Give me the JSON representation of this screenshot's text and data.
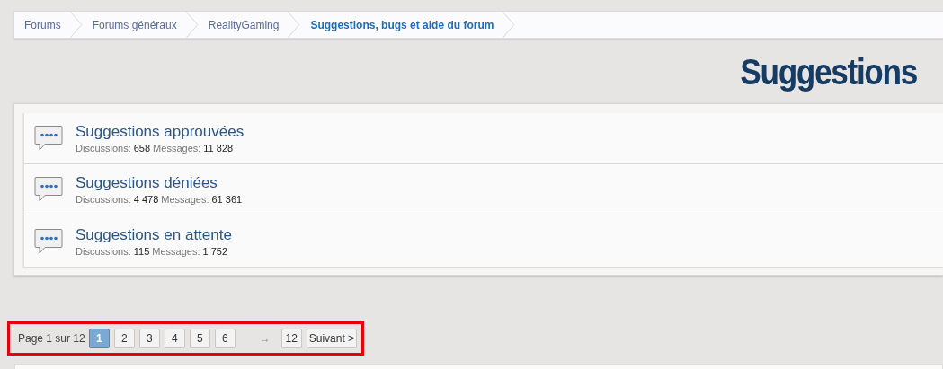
{
  "breadcrumb": [
    {
      "label": "Forums",
      "current": false
    },
    {
      "label": "Forums généraux",
      "current": false
    },
    {
      "label": "RealityGaming",
      "current": false
    },
    {
      "label": "Suggestions, bugs et aide du forum",
      "current": true
    }
  ],
  "title": "Suggestions",
  "forums": [
    {
      "name": "Suggestions approuvées",
      "discussions_label": "Discussions:",
      "discussions": "658",
      "messages_label": "Messages:",
      "messages": "11 828"
    },
    {
      "name": "Suggestions déniées",
      "discussions_label": "Discussions:",
      "discussions": "4 478",
      "messages_label": "Messages:",
      "messages": "61 361"
    },
    {
      "name": "Suggestions en attente",
      "discussions_label": "Discussions:",
      "discussions": "115",
      "messages_label": "Messages:",
      "messages": "1 752"
    }
  ],
  "pagination": {
    "highlighted": true,
    "summary": "Page 1 sur 12",
    "pages": [
      {
        "label": "1",
        "selected": true
      },
      {
        "label": "2",
        "selected": false
      },
      {
        "label": "3",
        "selected": false
      },
      {
        "label": "4",
        "selected": false
      },
      {
        "label": "5",
        "selected": false
      },
      {
        "label": "6",
        "selected": false
      }
    ],
    "skip": "→",
    "last": {
      "label": "12",
      "selected": false
    },
    "next": "Suivant >"
  }
}
